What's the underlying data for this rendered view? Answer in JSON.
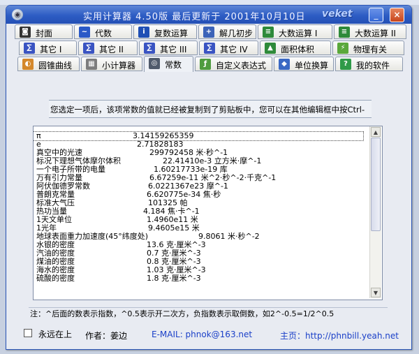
{
  "window": {
    "title": "实用计算器 4.50版   最后更新于 2001年10月10日",
    "brand": "veket",
    "minimize_glyph": "_",
    "close_glyph": "×"
  },
  "tabs": {
    "row1": [
      {
        "label": "封面",
        "icon": "camera-icon",
        "color": "#333333",
        "glyph": "◙"
      },
      {
        "label": "代数",
        "icon": "swirl-icon",
        "color": "#2a59c7",
        "glyph": "~"
      },
      {
        "label": "复数运算",
        "icon": "info-icon",
        "color": "#1f4fb5",
        "glyph": "i"
      },
      {
        "label": "解几初步",
        "icon": "axes-icon",
        "color": "#3c63b8",
        "glyph": "+"
      },
      {
        "label": "大数运算 I",
        "icon": "keyboard-icon",
        "color": "#2e8a3a",
        "glyph": "≡"
      },
      {
        "label": "大数运算 II",
        "icon": "keyboard-icon",
        "color": "#2e8a3a",
        "glyph": "≡"
      }
    ],
    "row2": [
      {
        "label": "其它 I",
        "icon": "bigmath-icon",
        "color": "#3a54c2",
        "glyph": "∑"
      },
      {
        "label": "其它 II",
        "icon": "bigmath-icon",
        "color": "#3a54c2",
        "glyph": "∑"
      },
      {
        "label": "其它 III",
        "icon": "bigmath-icon",
        "color": "#3a54c2",
        "glyph": "∑"
      },
      {
        "label": "其它 IV",
        "icon": "bigmath-icon",
        "color": "#3a54c2",
        "glyph": "∑"
      },
      {
        "label": "面积体积",
        "icon": "shapes-icon",
        "color": "#2e8a3a",
        "glyph": "▲"
      },
      {
        "label": "物理有关",
        "icon": "physics-icon",
        "color": "#5aa83b",
        "glyph": "⚡"
      }
    ],
    "row3": [
      {
        "label": "圆锥曲线",
        "icon": "conic-icon",
        "color": "#d4882b",
        "glyph": "◐"
      },
      {
        "label": "小计算器",
        "icon": "calculator-icon",
        "color": "#7d7d7d",
        "glyph": "▦"
      },
      {
        "label": "常数",
        "icon": "constant-icon",
        "color": "#4f5a6b",
        "glyph": "◎"
      },
      {
        "label": "自定义表达式",
        "icon": "fx-icon",
        "color": "#4f9c3f",
        "glyph": "ƒ"
      },
      {
        "label": "单位换算",
        "icon": "unit-icon",
        "color": "#3b69c4",
        "glyph": "◆"
      },
      {
        "label": "我的软件",
        "icon": "help-icon",
        "color": "#2f9a48",
        "glyph": "?"
      }
    ]
  },
  "notice": "您选定一项后，该项常数的值就已经被复制到了剪贴板中，您可以在其他编辑框中按Ctrl-",
  "constants": [
    {
      "name": "π",
      "value": "3.14159265359"
    },
    {
      "name": "e",
      "value": "2.71828183"
    },
    {
      "name": "真空中的光速",
      "value": "299792458 米·秒^-1"
    },
    {
      "name": "标况下理想气体摩尔体积",
      "value": "22.41410e-3 立方米·摩^-1"
    },
    {
      "name": "一个电子所带的电量",
      "value": "1.60217733e-19 库"
    },
    {
      "name": "万有引力常量",
      "value": "6.67259e-11 米^2·秒^-2·千克^-1"
    },
    {
      "name": "阿伏伽德罗常数",
      "value": "6.0221367e23 摩^-1"
    },
    {
      "name": "普朗克常量",
      "value": "6.620775e-34 焦·秒"
    },
    {
      "name": "标准大气压",
      "value": "101325 帕"
    },
    {
      "name": "热功当量",
      "value": "4.184 焦·卡^-1"
    },
    {
      "name": "1天文单位",
      "value": "1.4960e11 米"
    },
    {
      "name": "1光年",
      "value": "9.4605e15 米"
    },
    {
      "name": "地球表面重力加速度(45°纬度处)",
      "value": "9.8061 米·秒^-2"
    },
    {
      "name": "水银的密度",
      "value": "13.6 克·厘米^-3"
    },
    {
      "name": "汽油的密度",
      "value": "0.7 克·厘米^-3"
    },
    {
      "name": "煤油的密度",
      "value": "0.8 克·厘米^-3"
    },
    {
      "name": "海水的密度",
      "value": "1.03 克·厘米^-3"
    },
    {
      "name": "硫酸的密度",
      "value": "1.8 克·厘米^-3"
    }
  ],
  "note": "注：^后面的数表示指数，^0.5表示开二次方，负指数表示取倒数，如2^-0.5=1/2^0.5",
  "footer": {
    "always_on_top": "永远在上",
    "author": "作者：姜边",
    "email": "E-MAIL: phnok@163.net",
    "homepage": "主页：http://phnbill.yeah.net"
  }
}
